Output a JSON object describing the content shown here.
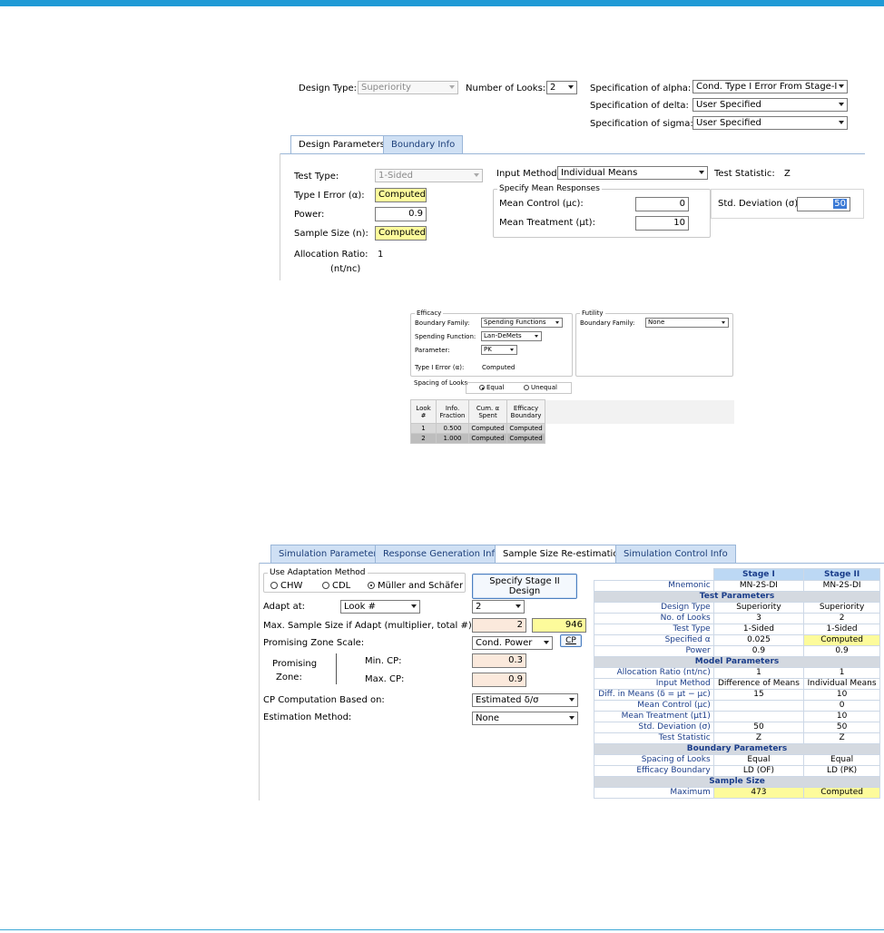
{
  "design": {
    "design_type_label": "Design Type:",
    "design_type_value": "Superiority",
    "num_looks_label": "Number of Looks:",
    "num_looks_value": "2",
    "alpha_label": "Specification of alpha:",
    "alpha_value": "Cond. Type I Error From Stage-I",
    "delta_label": "Specification of delta:",
    "delta_value": "User Specified",
    "sigma_label": "Specification of sigma:",
    "sigma_value": "User Specified"
  },
  "tabs1": [
    "Design Parameters",
    "Boundary Info"
  ],
  "params": {
    "test_type_label": "Test Type:",
    "test_type_value": "1-Sided",
    "type1_label": "Type I Error (α):",
    "type1_value": "Computed",
    "power_label": "Power:",
    "power_value": "0.9",
    "sample_size_label": "Sample Size (n):",
    "sample_size_value": "Computed",
    "alloc_label": "Allocation Ratio:",
    "alloc_value": "1",
    "alloc_sub": "(nt/nc)",
    "input_method_label": "Input Method:",
    "input_method_value": "Individual Means",
    "test_stat_label": "Test Statistic:",
    "test_stat_value": "Z",
    "mean_group_legend": "Specify Mean Responses",
    "mean_control_label": "Mean Control (μc):",
    "mean_control_value": "0",
    "mean_treat_label": "Mean Treatment (μt):",
    "mean_treat_value": "10",
    "std_dev_label": "Std. Deviation (σ):",
    "std_dev_value": "50"
  },
  "boundary": {
    "efficacy_legend": "Efficacy",
    "eff_family_label": "Boundary Family:",
    "eff_family_value": "Spending Functions",
    "spend_fn_label": "Spending Function:",
    "spend_fn_value": "Lan-DeMets",
    "parameter_label": "Parameter:",
    "parameter_value": "PK",
    "type1_label": "Type I Error (α):",
    "type1_value": "Computed",
    "futility_legend": "Futility",
    "fut_family_label": "Boundary Family:",
    "fut_family_value": "None",
    "spacing_legend": "Spacing of Looks",
    "equal_label": "Equal",
    "unequal_label": "Unequal",
    "grid_headers": [
      "Look #",
      "Info. Fraction",
      "Cum. α Spent",
      "Efficacy Boundary"
    ],
    "grid_rows": [
      [
        "1",
        "0.500",
        "Computed",
        "Computed"
      ],
      [
        "2",
        "1.000",
        "Computed",
        "Computed"
      ]
    ]
  },
  "tabs2": [
    "Simulation Parameters",
    "Response Generation Info",
    "Sample Size Re-estimation",
    "Simulation Control Info"
  ],
  "ssr": {
    "adapt_legend": "Use Adaptation Method",
    "chw": "CHW",
    "cdl": "CDL",
    "ms": "Müller and Schäfer",
    "stage2_button": "Specify Stage II Design",
    "adapt_at_label": "Adapt at:",
    "adapt_at_value": "Look #",
    "adapt_at_look": "2",
    "max_ss_label": "Max. Sample Size if Adapt (multiplier, total #):",
    "max_ss_mult": "2",
    "max_ss_total": "946",
    "pz_scale_label": "Promising Zone Scale:",
    "pz_scale_value": "Cond. Power",
    "cp_button": "CP",
    "pz_label_1": "Promising",
    "pz_label_2": "Zone:",
    "min_cp_label": "Min. CP:",
    "min_cp_value": "0.3",
    "max_cp_label": "Max. CP:",
    "max_cp_value": "0.9",
    "cp_comp_label": "CP Computation Based on:",
    "cp_comp_value": "Estimated δ/σ",
    "est_method_label": "Estimation Method:",
    "est_method_value": "None"
  },
  "summary": {
    "col1": "Stage I",
    "col2": "Stage II",
    "rows": [
      {
        "type": "row",
        "k": "Mnemonic",
        "a": "MN-2S-DI",
        "b": "MN-2S-DI"
      },
      {
        "type": "sec",
        "k": "Test Parameters"
      },
      {
        "type": "row",
        "k": "Design Type",
        "a": "Superiority",
        "b": "Superiority"
      },
      {
        "type": "row",
        "k": "No. of Looks",
        "a": "3",
        "b": "2"
      },
      {
        "type": "row",
        "k": "Test Type",
        "a": "1-Sided",
        "b": "1-Sided"
      },
      {
        "type": "row",
        "k": "Specified α",
        "a": "0.025",
        "b": "Computed",
        "by": true
      },
      {
        "type": "row",
        "k": "Power",
        "a": "0.9",
        "b": "0.9"
      },
      {
        "type": "sec",
        "k": "Model Parameters"
      },
      {
        "type": "row",
        "k": "Allocation Ratio (nt/nc)",
        "a": "1",
        "b": "1"
      },
      {
        "type": "row",
        "k": "Input Method",
        "a": "Difference of Means",
        "b": "Individual Means"
      },
      {
        "type": "row",
        "k": "Diff. in Means (δ = μt − μc)",
        "a": "15",
        "b": "10"
      },
      {
        "type": "row",
        "k": "Mean Control (μc)",
        "a": "",
        "b": "0"
      },
      {
        "type": "row",
        "k": "Mean Treatment (μt1)",
        "a": "",
        "b": "10"
      },
      {
        "type": "row",
        "k": "Std. Deviation (σ)",
        "a": "50",
        "b": "50"
      },
      {
        "type": "row",
        "k": "Test Statistic",
        "a": "Z",
        "b": "Z"
      },
      {
        "type": "sec",
        "k": "Boundary Parameters"
      },
      {
        "type": "row",
        "k": "Spacing of Looks",
        "a": "Equal",
        "b": "Equal"
      },
      {
        "type": "row",
        "k": "Efficacy Boundary",
        "a": "LD (OF)",
        "b": "LD (PK)"
      },
      {
        "type": "sec",
        "k": "Sample Size"
      },
      {
        "type": "row",
        "k": "Maximum",
        "a": "473",
        "b": "Computed",
        "ay": true,
        "by": true
      }
    ]
  }
}
